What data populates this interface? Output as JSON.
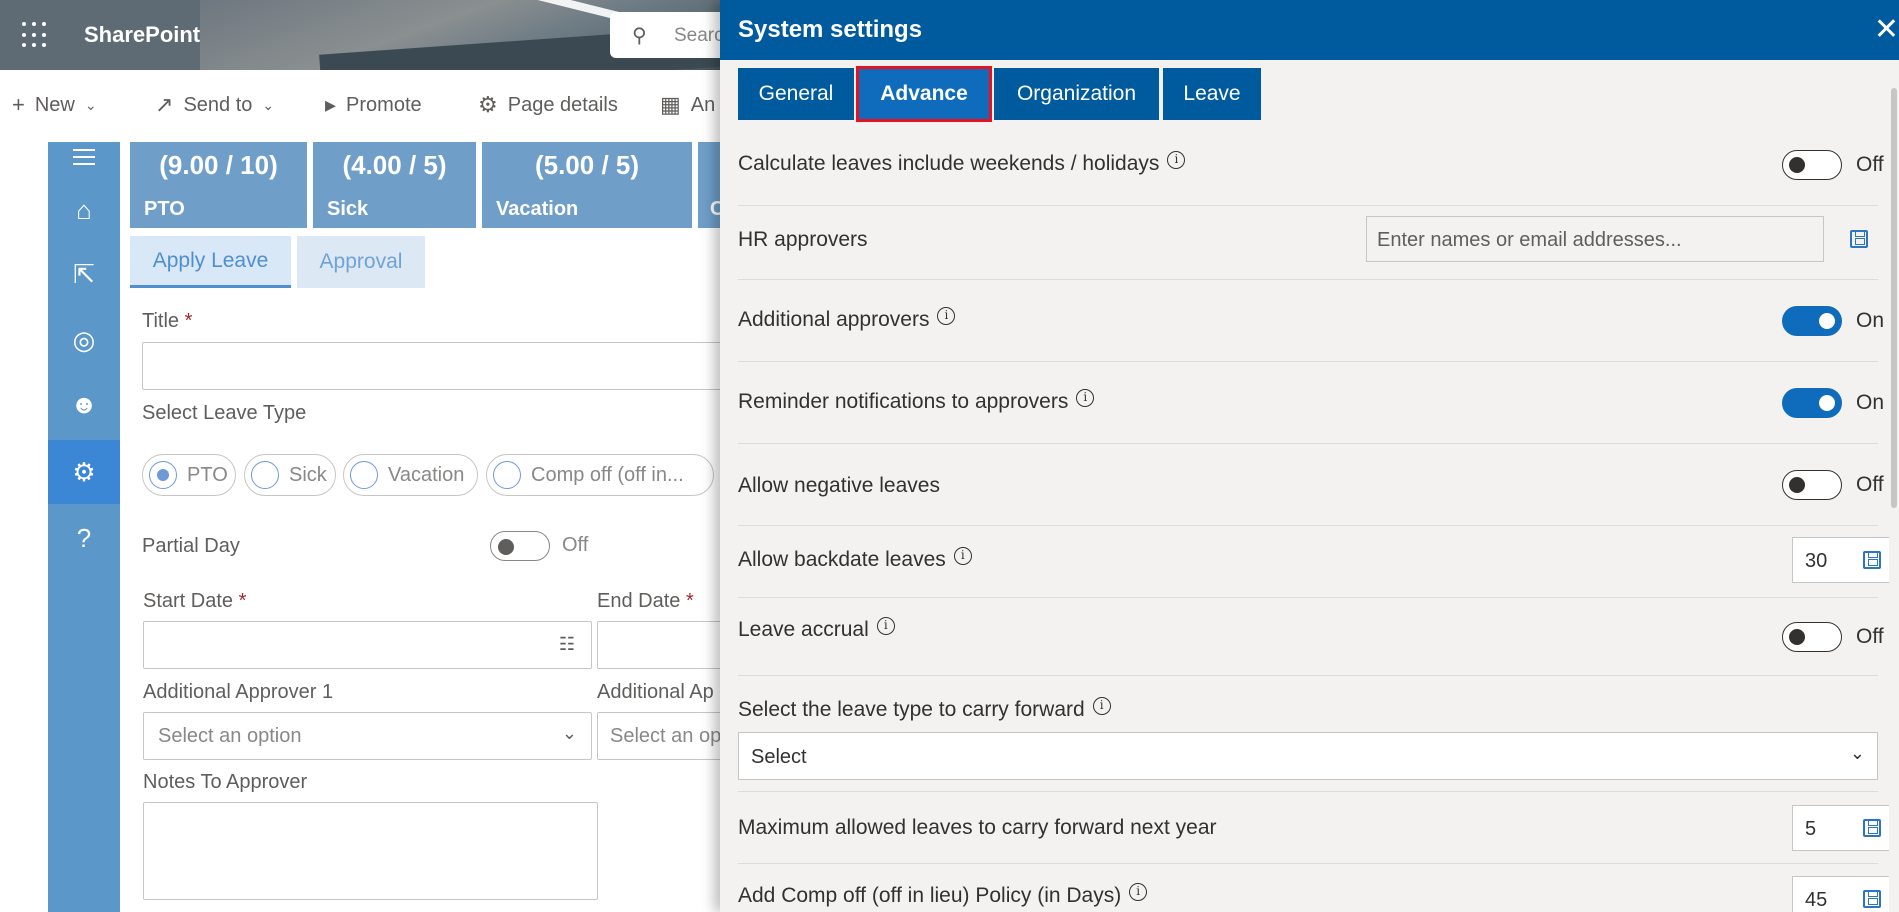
{
  "suitebar": {
    "app_name": "SharePoint",
    "search_placeholder": "Searc"
  },
  "commands": {
    "new": "New",
    "send_to": "Send to",
    "promote": "Promote",
    "page_details": "Page details",
    "analytics": "An"
  },
  "cards": [
    {
      "value": "(9.00 / 10)",
      "name": "PTO"
    },
    {
      "value": "(4.00 / 5)",
      "name": "Sick"
    },
    {
      "value": "(5.00 / 5)",
      "name": "Vacation"
    },
    {
      "value": "",
      "name": "C"
    }
  ],
  "bg_tabs": {
    "apply": "Apply Leave",
    "approval": "Approval"
  },
  "form": {
    "title_label": "Title",
    "required_mark": "*",
    "leave_type_label": "Select Leave Type",
    "leave_types": [
      "PTO",
      "Sick",
      "Vacation",
      "Comp off (off in..."
    ],
    "partial_day_label": "Partial Day",
    "partial_day_state": "Off",
    "start_date_label": "Start Date",
    "end_date_label": "End Date",
    "approver1_label": "Additional Approver 1",
    "approver2_label": "Additional Ap",
    "approver1_placeholder": "Select an option",
    "approver2_placeholder": "Select an op",
    "notes_label": "Notes To Approver"
  },
  "panel": {
    "title": "System settings",
    "tabs": [
      "General",
      "Advance",
      "Organization",
      "Leave"
    ],
    "active_tab": "Advance",
    "settings": {
      "calc_weekends": {
        "label": "Calculate leaves include weekends / holidays",
        "state": "Off"
      },
      "hr_approvers": {
        "label": "HR approvers",
        "placeholder": "Enter names or email addresses..."
      },
      "additional_approvers": {
        "label": "Additional approvers",
        "state": "On"
      },
      "reminder": {
        "label": "Reminder notifications to approvers",
        "state": "On"
      },
      "negative": {
        "label": "Allow negative leaves",
        "state": "Off"
      },
      "backdate": {
        "label": "Allow backdate leaves",
        "value": "30"
      },
      "accrual": {
        "label": "Leave accrual",
        "state": "Off"
      },
      "carry_type": {
        "label": "Select the leave type to carry forward",
        "selected": "Select"
      },
      "max_carry": {
        "label": "Maximum allowed leaves to carry forward next year",
        "value": "5"
      },
      "comp_off": {
        "label": "Add Comp off (off in lieu) Policy (in Days)",
        "value": "45"
      }
    }
  },
  "colors": {
    "header_blue": "#005a9e",
    "active_tab_outline": "#e81123",
    "toggle_on": "#0f6cbd",
    "rail": "#5b97c9"
  }
}
